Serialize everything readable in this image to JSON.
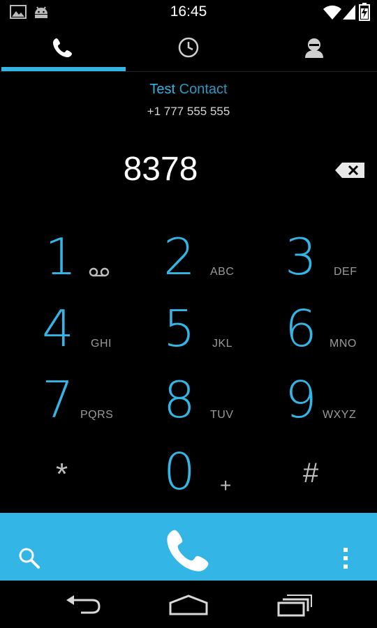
{
  "status_bar": {
    "time": "16:45",
    "left_icons": [
      "gallery-notification-icon",
      "android-notification-icon"
    ],
    "right_icons": [
      "wifi-icon",
      "cell-signal-icon",
      "battery-charging-icon"
    ]
  },
  "tabs": [
    {
      "name": "dialer",
      "icon": "phone-icon",
      "selected": true
    },
    {
      "name": "recent",
      "icon": "clock-icon",
      "selected": false
    },
    {
      "name": "contacts",
      "icon": "person-icon",
      "selected": false
    }
  ],
  "contact": {
    "name_match": "Test",
    "name_rest": " Contact",
    "number": "+1 777 555 555"
  },
  "dialer": {
    "digits": "8378"
  },
  "keypad": {
    "k1": {
      "num": "1",
      "letters": ""
    },
    "k2": {
      "num": "2",
      "letters": "ABC"
    },
    "k3": {
      "num": "3",
      "letters": "DEF"
    },
    "k4": {
      "num": "4",
      "letters": "GHI"
    },
    "k5": {
      "num": "5",
      "letters": "JKL"
    },
    "k6": {
      "num": "6",
      "letters": "MNO"
    },
    "k7": {
      "num": "7",
      "letters": "PQRS"
    },
    "k8": {
      "num": "8",
      "letters": "TUV"
    },
    "k9": {
      "num": "9",
      "letters": "WXYZ"
    },
    "star": {
      "num": "*"
    },
    "k0": {
      "num": "0",
      "letters": "+"
    },
    "pound": {
      "num": "#"
    }
  },
  "colors": {
    "accent": "#33b5e5",
    "background": "#000000",
    "letters": "#9a9a9a"
  }
}
